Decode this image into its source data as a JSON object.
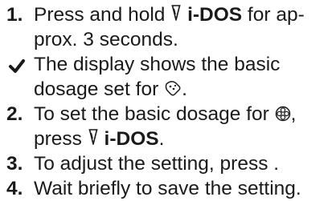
{
  "steps": [
    {
      "marker": "1.",
      "lines": [
        {
          "before": "Press and hold ",
          "icon": "idos-drop-icon",
          "keyword": "i-DOS",
          "after": " for ap-"
        },
        {
          "before": "prox. 3 seconds."
        }
      ]
    },
    {
      "marker_icon": "checkmark-icon",
      "lines": [
        {
          "before": "The display shows the basic"
        },
        {
          "before": "dosage set for ",
          "icon": "dosage-symbol-icon",
          "after": "."
        }
      ]
    },
    {
      "marker": "2.",
      "lines": [
        {
          "before": "To set the basic dosage for ",
          "icon": "flower-symbol-icon",
          "after": ","
        },
        {
          "before": "press ",
          "icon": "idos-drop-icon",
          "keyword": "i-DOS",
          "after": "."
        }
      ]
    },
    {
      "marker": "3.",
      "lines": [
        {
          "before": "To adjust the setting, press ."
        }
      ]
    },
    {
      "marker": "4.",
      "lines": [
        {
          "before": "Wait briefly to save the setting."
        }
      ]
    }
  ]
}
